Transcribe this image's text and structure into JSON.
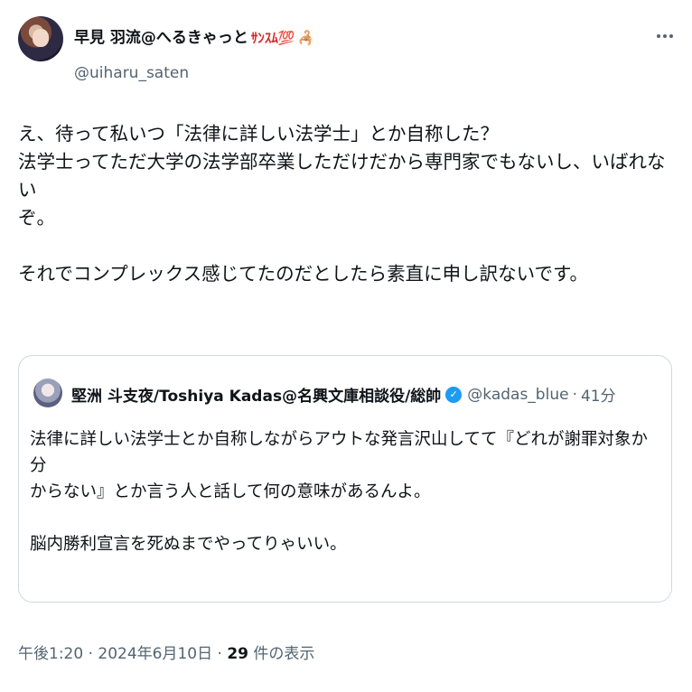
{
  "author": {
    "name": "早見 羽流@へるきゃっと",
    "badge_text": "ｻﾝｽﾑ💯",
    "badge_emoji": "🦂",
    "handle": "@uiharu_saten"
  },
  "tweet": {
    "text": "え、待って私いつ「法律に詳しい法学士」とか自称した？\n法学士ってただ大学の法学部卒業しただけだから専門家でもないし、いばれない\nぞ。\n\nそれでコンプレックス感じてたのだとしたら素直に申し訳ないです。"
  },
  "quote": {
    "name": "堅洲 斗支夜/Toshiya Kadas@名興文庫相談役/総帥",
    "verified_glyph": "✓",
    "handle": "@kadas_blue",
    "separator": "·",
    "time": "41分",
    "text": "法律に詳しい法学士とか自称しながらアウトな発言沢山してて『どれが謝罪対象か分\nからない』とか言う人と話して何の意味があるんよ。\n\n脳内勝利宣言を死ぬまでやってりゃいい。"
  },
  "meta": {
    "time": "午後1:20",
    "sep1": " · ",
    "date": "2024年6月10日",
    "sep2": " · ",
    "views_count": "29",
    "views_label": " 件の表示"
  },
  "icons": {
    "more": "more-horizontal-icon",
    "verified": "verified-badge-icon"
  },
  "colors": {
    "text": "#0f1419",
    "secondary": "#536471",
    "border": "#cfd9de",
    "verified": "#1d9bf0"
  }
}
